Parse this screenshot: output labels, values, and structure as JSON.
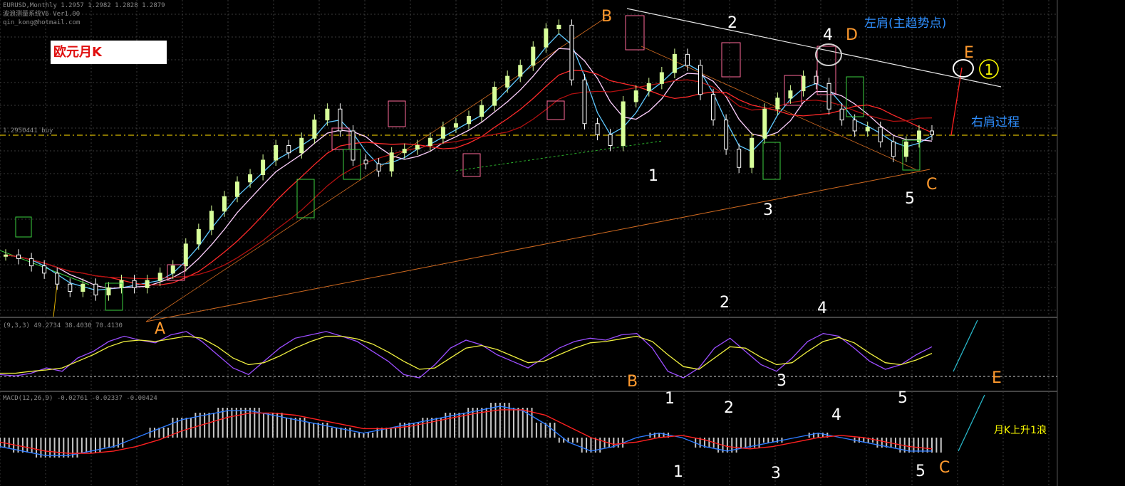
{
  "header": {
    "symbol_line": "EURUSD,Monthly  1.2957 1.2982 1.2828 1.2879",
    "indicator_line": "波浪测量系统V6  Ver1.00",
    "author_line": "qin_kong@hotmail.com",
    "level_label": "1.2950441 buy",
    "osc_label": "(9,3,3) 49.2734 38.4030 70.4130",
    "macd_label": "MACD(12,26,9) -0.02761 -0.02337 -0.00424"
  },
  "title": "欧元月K",
  "annotations": {
    "left_shoulder": "左肩(主趋势点)",
    "right_shoulder": "右肩过程",
    "macd_note": "月K上升1浪",
    "circle_one": "1"
  },
  "wave_labels": {
    "main": [
      {
        "text": "A",
        "color": "#ff9a2e"
      },
      {
        "text": "B",
        "color": "#ff9a2e"
      },
      {
        "text": "1",
        "color": "#ffffff"
      },
      {
        "text": "2",
        "color": "#ffffff"
      },
      {
        "text": "3",
        "color": "#ffffff"
      },
      {
        "text": "4",
        "color": "#ffffff"
      },
      {
        "text": "D",
        "color": "#ff9a2e"
      },
      {
        "text": "5",
        "color": "#ffffff"
      },
      {
        "text": "C",
        "color": "#ff9a2e"
      },
      {
        "text": "E",
        "color": "#ff9a2e"
      }
    ],
    "oscillator": [
      "2",
      "4",
      "B",
      "1",
      "3",
      "5",
      "E"
    ],
    "macd": [
      "1",
      "2",
      "4",
      "5",
      "1",
      "3",
      "5",
      "C"
    ]
  },
  "colors": {
    "background": "#000000",
    "grid": "#3a3a3a",
    "bull_candle": "#d8ff9a",
    "bear_candle": "#ffffff",
    "ma_fast": "#5ec8ff",
    "ma_slow": "#ff2a2a",
    "osc_k": "#9b4dff",
    "osc_d": "#f0f040",
    "macd_line": "#2d7bff",
    "signal_line": "#ff2020",
    "wave_orange": "#ff9a2e",
    "annotation_blue": "#2f8fff",
    "annotation_yellow": "#ffff00"
  },
  "chart_data": [
    {
      "type": "candlestick",
      "title": "欧元月K",
      "series": [
        {
          "name": "price",
          "values": [
            0.96,
            0.95,
            0.93,
            0.91,
            0.88,
            0.86,
            0.88,
            0.85,
            0.87,
            0.89,
            0.87,
            0.89,
            0.91,
            0.93,
            0.99,
            1.03,
            1.08,
            1.12,
            1.16,
            1.18,
            1.22,
            1.26,
            1.24,
            1.28,
            1.33,
            1.36,
            1.3,
            1.22,
            1.21,
            1.19,
            1.24,
            1.25,
            1.26,
            1.28,
            1.31,
            1.32,
            1.34,
            1.37,
            1.42,
            1.45,
            1.48,
            1.53,
            1.58,
            1.59,
            1.44,
            1.32,
            1.29,
            1.26,
            1.38,
            1.41,
            1.43,
            1.46,
            1.51,
            1.48,
            1.4,
            1.33,
            1.25,
            1.2,
            1.28,
            1.36,
            1.39,
            1.41,
            1.45,
            1.43,
            1.36,
            1.33,
            1.3,
            1.31,
            1.27,
            1.23,
            1.27,
            1.3,
            1.29
          ]
        }
      ]
    },
    {
      "type": "line",
      "title": "(9,3,3) 49.2734 38.4030 70.4130",
      "series": [
        {
          "name": "K",
          "values": [
            20,
            18,
            22,
            30,
            25,
            45,
            55,
            70,
            78,
            72,
            68,
            80,
            85,
            70,
            50,
            30,
            20,
            40,
            60,
            75,
            80,
            85,
            78,
            70,
            55,
            40,
            20,
            15,
            35,
            60,
            72,
            65,
            50,
            40,
            30,
            45,
            60,
            70,
            75,
            72,
            80,
            82,
            60,
            25,
            15,
            30,
            60,
            75,
            55,
            35,
            25,
            45,
            70,
            82,
            78,
            60,
            40,
            28,
            35,
            50,
            62
          ]
        },
        {
          "name": "D",
          "values": [
            22,
            22,
            25,
            27,
            30,
            40,
            50,
            62,
            70,
            72,
            70,
            74,
            78,
            75,
            62,
            45,
            35,
            38,
            48,
            60,
            70,
            78,
            78,
            74,
            66,
            54,
            40,
            28,
            30,
            45,
            60,
            64,
            58,
            48,
            38,
            40,
            50,
            60,
            68,
            70,
            74,
            78,
            70,
            50,
            32,
            28,
            45,
            62,
            60,
            46,
            35,
            38,
            55,
            70,
            76,
            68,
            52,
            38,
            35,
            42,
            52
          ]
        }
      ]
    },
    {
      "type": "bar",
      "title": "MACD(12,26,9) -0.02761 -0.02337 -0.00424",
      "series": [
        {
          "name": "MACD",
          "values": [
            -0.02,
            -0.03,
            -0.04,
            -0.04,
            -0.03,
            -0.02,
            0.0,
            0.02,
            0.04,
            0.05,
            0.06,
            0.06,
            0.05,
            0.04,
            0.03,
            0.02,
            0.01,
            0.02,
            0.03,
            0.04,
            0.05,
            0.06,
            0.07,
            0.06,
            0.03,
            -0.01,
            -0.03,
            -0.02,
            0.0,
            0.01,
            0.0,
            -0.02,
            -0.03,
            -0.02,
            -0.01,
            0.0,
            0.01,
            0.0,
            -0.01,
            -0.02,
            -0.03,
            -0.03
          ]
        },
        {
          "name": "Signal",
          "values": [
            -0.01,
            -0.02,
            -0.03,
            -0.035,
            -0.035,
            -0.03,
            -0.02,
            -0.005,
            0.015,
            0.03,
            0.045,
            0.055,
            0.055,
            0.05,
            0.04,
            0.03,
            0.02,
            0.02,
            0.025,
            0.035,
            0.045,
            0.055,
            0.062,
            0.062,
            0.05,
            0.025,
            0.0,
            -0.015,
            -0.01,
            0.0,
            0.005,
            -0.005,
            -0.02,
            -0.025,
            -0.02,
            -0.01,
            0.0,
            0.005,
            0.0,
            -0.01,
            -0.02,
            -0.025
          ]
        }
      ]
    }
  ]
}
